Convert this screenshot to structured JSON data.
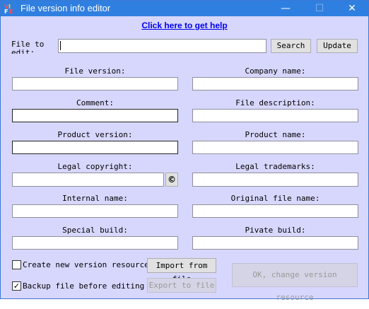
{
  "window": {
    "title": "File version info editor",
    "minimize_glyph": "—",
    "maximize_glyph": "☐",
    "close_glyph": "✕"
  },
  "help_link": "Click here to get help",
  "file_to_edit": {
    "label": "File to edit:",
    "value": "",
    "search_label": "Search",
    "update_label": "Update"
  },
  "fields": {
    "file_version": {
      "label": "File version:",
      "value": ""
    },
    "company_name": {
      "label": "Company name:",
      "value": ""
    },
    "comment": {
      "label": "Comment:",
      "value": ""
    },
    "file_description": {
      "label": "File description:",
      "value": ""
    },
    "product_version": {
      "label": "Product version:",
      "value": ""
    },
    "product_name": {
      "label": "Product name:",
      "value": ""
    },
    "legal_copyright": {
      "label": "Legal copyright:",
      "value": "",
      "symbol_button": "©"
    },
    "legal_trademarks": {
      "label": "Legal trademarks:",
      "value": ""
    },
    "internal_name": {
      "label": "Internal name:",
      "value": ""
    },
    "original_file_name": {
      "label": "Original file name:",
      "value": ""
    },
    "special_build": {
      "label": "Special build:",
      "value": ""
    },
    "private_build": {
      "label": "Pivate build:",
      "value": ""
    }
  },
  "options": {
    "create_new_version": {
      "label": "Create new version resource",
      "checked": false
    },
    "backup_before_editing": {
      "label": "Backup file before editing",
      "checked": true
    }
  },
  "buttons": {
    "import_from_file": "Import from file",
    "export_to_file": "Export to file",
    "ok_change": "OK, change version resource"
  },
  "colors": {
    "titlebar": "#2f7fe0",
    "background": "#d7d7fe",
    "link": "#0000ee"
  }
}
